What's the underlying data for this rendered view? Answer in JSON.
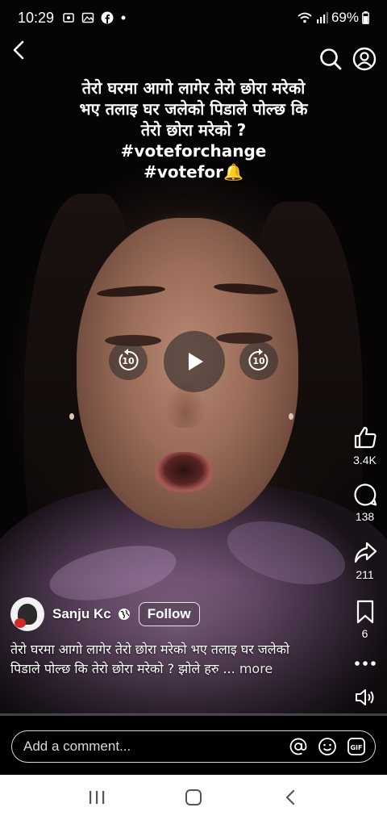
{
  "status_bar": {
    "time": "10:29",
    "battery": "69%"
  },
  "overlay": {
    "lines": [
      "तेरो घरमा आगो लागेर तेरो छोरा मरेको",
      "भए तलाइ घर जलेको पिडाले पोल्छ कि",
      "तेरो छोरा मरेको ?",
      "#voteforchange",
      "#votefor🔔"
    ]
  },
  "playback": {
    "rewind_seconds": "10",
    "forward_seconds": "10"
  },
  "actions": {
    "like_count": "3.4K",
    "comment_count": "138",
    "share_count": "211",
    "save_count": "6"
  },
  "author": {
    "name": "Sanju Kc",
    "follow_label": "Follow"
  },
  "caption": {
    "line1": "तेरो घरमा आगो लागेर तेरो छोरा मरेको भए तलाइ घर जलेको",
    "line2": "पिडाले पोल्छ कि तेरो छोरा मरेको ? झोले हरु ... ",
    "more_label": "more"
  },
  "progress": {
    "fraction": 0.0
  },
  "comment": {
    "placeholder": "Add a comment..."
  },
  "icons": {
    "back": "chevron-left-icon",
    "search": "search-icon",
    "profile": "profile-icon",
    "like": "thumbs-up-icon",
    "comment": "comment-icon",
    "share": "share-icon",
    "save": "bookmark-icon",
    "more": "more-dots-icon",
    "volume": "speaker-icon"
  }
}
